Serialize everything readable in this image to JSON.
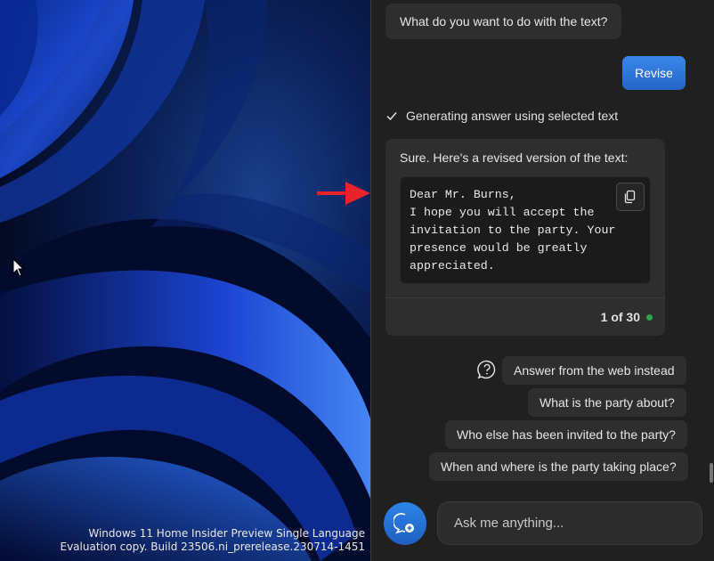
{
  "desktop": {
    "watermark_line1": "Windows 11 Home Insider Preview Single Language",
    "watermark_line2": "Evaluation copy. Build 23506.ni_prerelease.230714-1451"
  },
  "copilot": {
    "question": "What do you want to do with the text?",
    "user_choice": "Revise",
    "status": "Generating answer using selected text",
    "answer_intro": "Sure. Here's a revised version of the text:",
    "answer_text": "Dear Mr. Burns,\nI hope you will accept the\ninvitation to the party. Your\npresence would be greatly\nappreciated.",
    "counter": "1 of 30",
    "suggestions": [
      "Answer from the web instead",
      "What is the party about?",
      "Who else has been invited to the party?",
      "When and where is the party taking place?"
    ],
    "input_placeholder": "Ask me anything...",
    "colors": {
      "accent": "#2f7be0",
      "status_dot": "#2fa34f",
      "annotation_arrow": "#e8242a"
    }
  }
}
